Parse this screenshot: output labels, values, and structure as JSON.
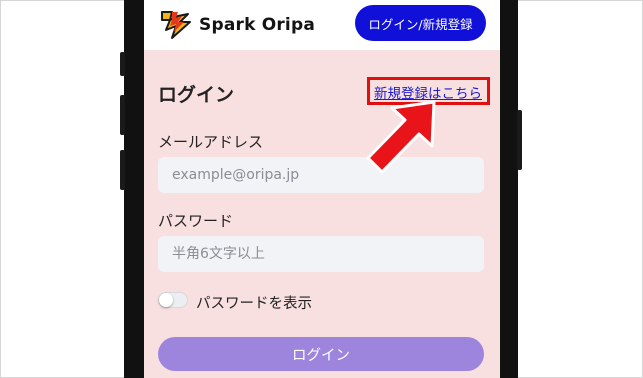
{
  "header": {
    "brand": "Spark Oripa",
    "login_register_button": "ログイン/新規登録"
  },
  "login_form": {
    "title": "ログイン",
    "register_link": "新規登録はこちら",
    "email_label": "メールアドレス",
    "email_placeholder": "example@oripa.jp",
    "password_label": "パスワード",
    "password_placeholder": "半角6文字以上",
    "show_password_label": "パスワードを表示",
    "show_password_enabled": false,
    "submit_button": "ログイン"
  },
  "annotation": {
    "highlight_color": "#e01010",
    "arrow_icon": "red-arrow-icon"
  },
  "colors": {
    "header_button": "#1010d8",
    "page_background": "#f8dfe0",
    "submit_button": "#9d84dd",
    "link": "#1a1ad0"
  }
}
